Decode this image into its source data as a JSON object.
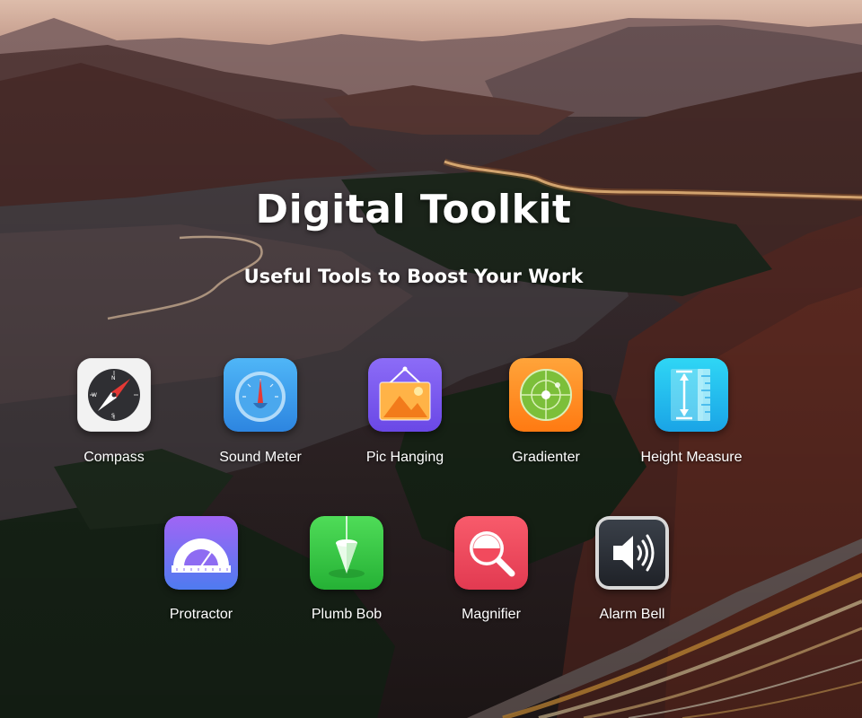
{
  "header": {
    "title": "Digital Toolkit",
    "subtitle": "Useful Tools to Boost Your Work"
  },
  "apps": [
    {
      "label": "Compass",
      "icon": "compass-icon"
    },
    {
      "label": "Sound Meter",
      "icon": "sound-meter-icon"
    },
    {
      "label": "Pic Hanging",
      "icon": "picture-frame-icon"
    },
    {
      "label": "Gradienter",
      "icon": "level-target-icon"
    },
    {
      "label": "Height Measure",
      "icon": "ruler-icon"
    },
    {
      "label": "Protractor",
      "icon": "protractor-icon"
    },
    {
      "label": "Plumb Bob",
      "icon": "plumb-bob-icon"
    },
    {
      "label": "Magnifier",
      "icon": "magnifier-icon"
    },
    {
      "label": "Alarm Bell",
      "icon": "speaker-icon"
    }
  ],
  "colors": {
    "sound_meter": "#3aa0ee",
    "pic_hanging": "#7b5cf0",
    "gradienter": "#ff8a1e",
    "height_measure": "#1fc1f0",
    "protractor": "#8e5cf2",
    "plumb_bob": "#3ed04a",
    "magnifier": "#f04a5e",
    "alarm_bell": "#2b2f36"
  }
}
